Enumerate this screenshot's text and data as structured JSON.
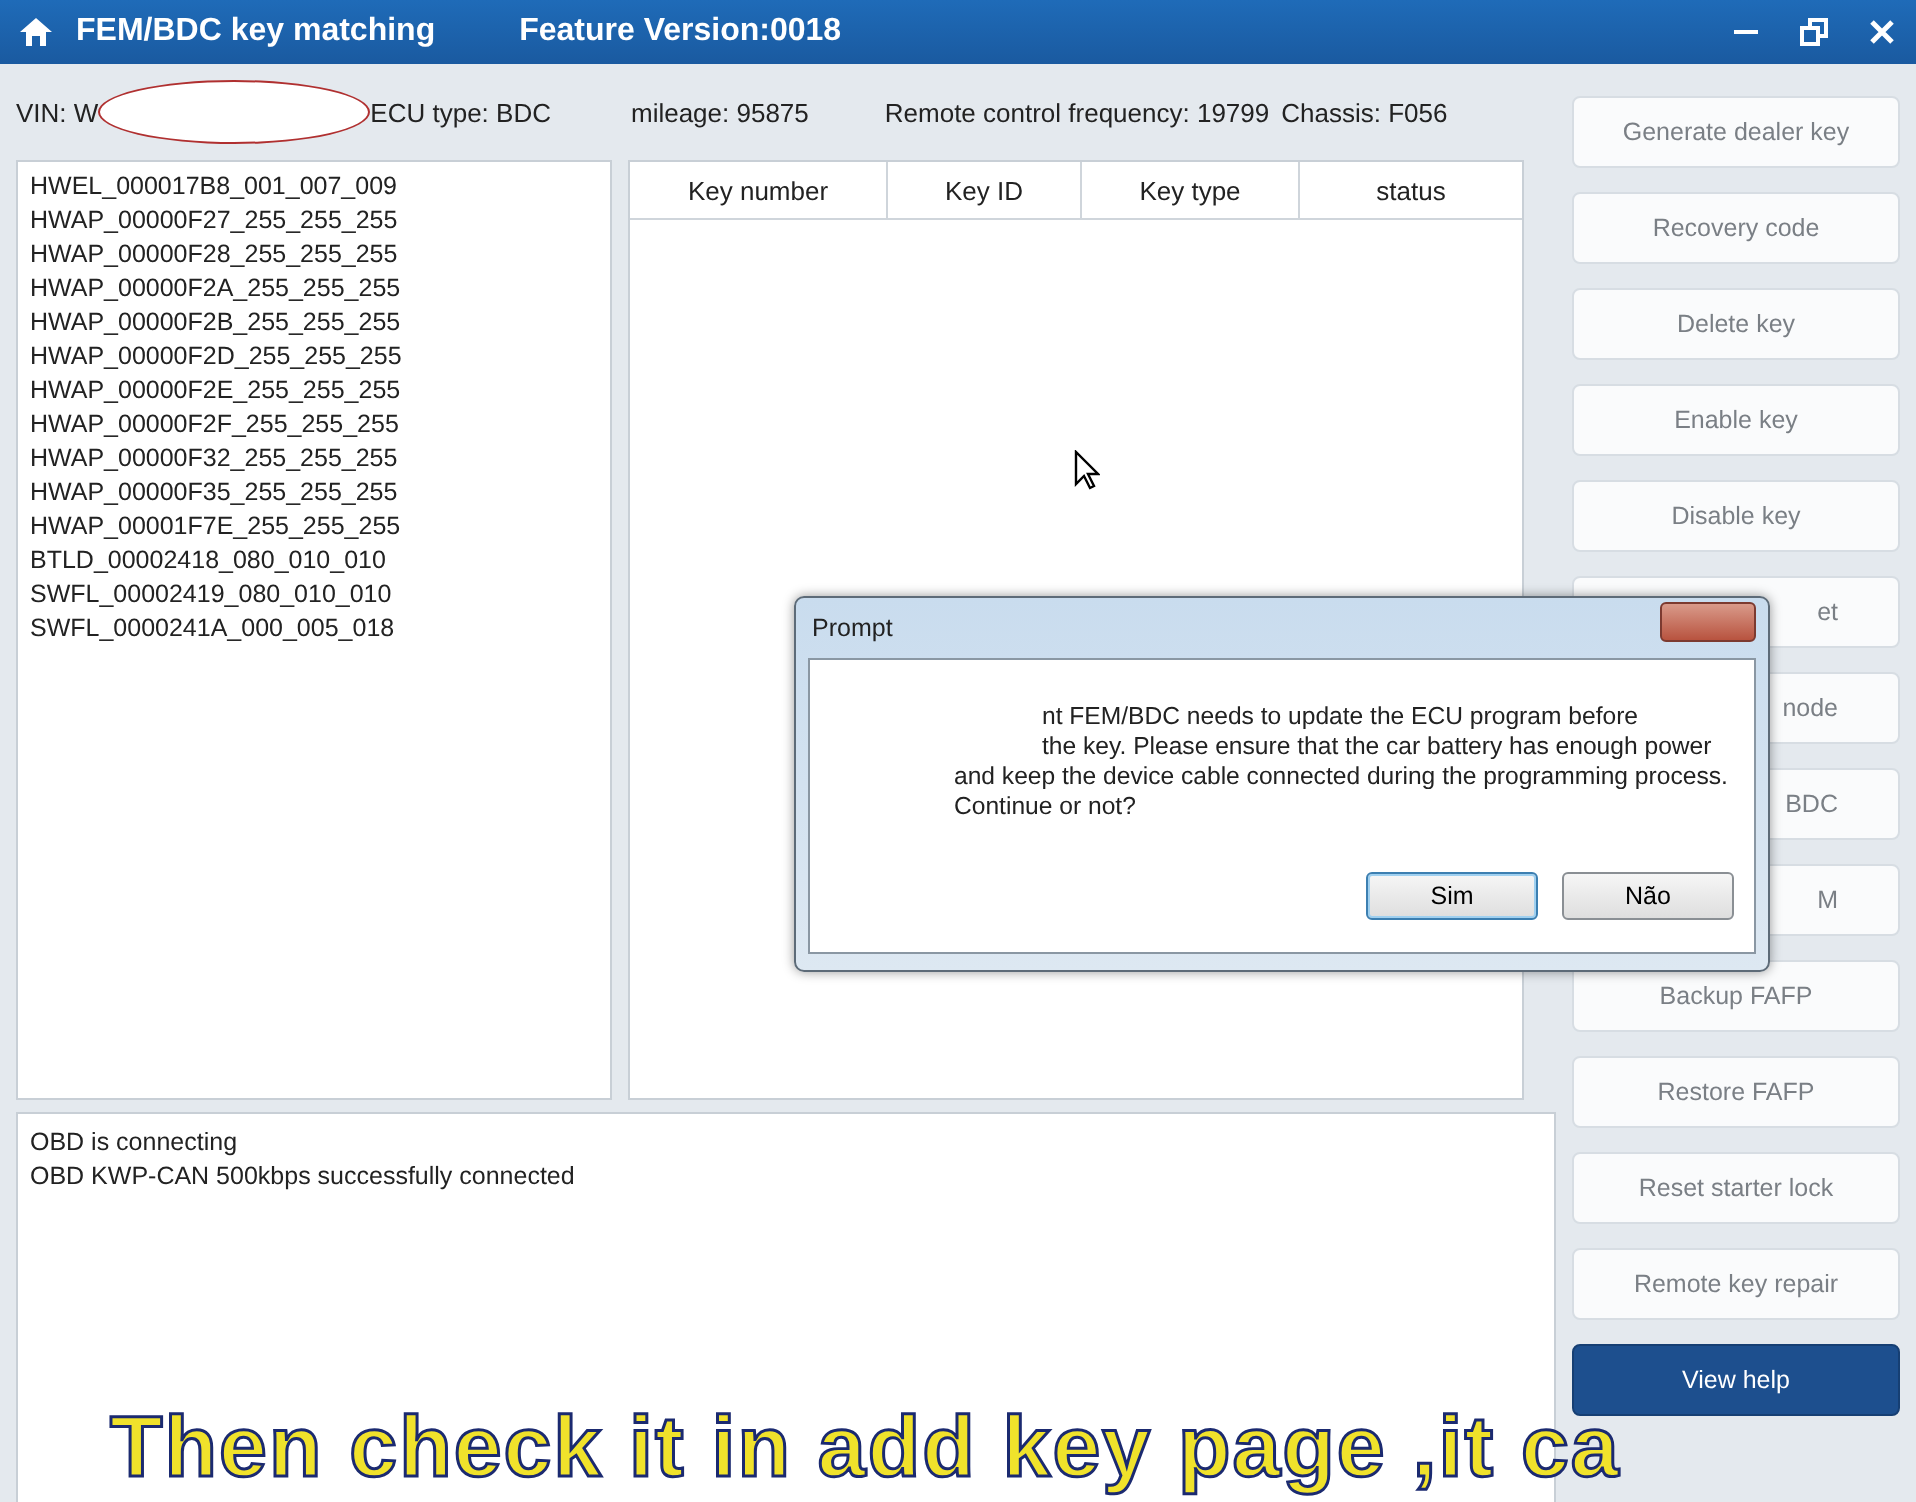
{
  "window": {
    "title": "FEM/BDC key matching",
    "feature_version": "Feature Version:0018"
  },
  "info": {
    "vin": "VIN: W",
    "ecu_type": "ECU type: BDC",
    "mileage": "mileage: 95875",
    "frequency": "Remote control frequency: 19799",
    "chassis": "Chassis: F056"
  },
  "modules": [
    "HWEL_000017B8_001_007_009",
    "HWAP_00000F27_255_255_255",
    "HWAP_00000F28_255_255_255",
    "HWAP_00000F2A_255_255_255",
    "HWAP_00000F2B_255_255_255",
    "HWAP_00000F2D_255_255_255",
    "HWAP_00000F2E_255_255_255",
    "HWAP_00000F2F_255_255_255",
    "HWAP_00000F32_255_255_255",
    "HWAP_00000F35_255_255_255",
    "HWAP_00001F7E_255_255_255",
    "BTLD_00002418_080_010_010",
    "SWFL_00002419_080_010_010",
    "SWFL_0000241A_000_005_018"
  ],
  "table": {
    "columns": [
      "Key number",
      "Key ID",
      "Key type",
      "status"
    ]
  },
  "log": [
    "OBD is connecting",
    "OBD KWP-CAN 500kbps successfully connected"
  ],
  "buttons": [
    {
      "label": "Generate dealer key",
      "kind": "full",
      "selected": false
    },
    {
      "label": "Recovery code",
      "kind": "full",
      "selected": false
    },
    {
      "label": "Delete key",
      "kind": "full",
      "selected": false
    },
    {
      "label": "Enable key",
      "kind": "full",
      "selected": false
    },
    {
      "label": "Disable key",
      "kind": "full",
      "selected": false
    },
    {
      "label": "et",
      "kind": "partial",
      "selected": false
    },
    {
      "label": "node",
      "kind": "partial",
      "selected": false
    },
    {
      "label": "BDC",
      "kind": "partial",
      "selected": false
    },
    {
      "label": "M",
      "kind": "partial",
      "selected": false
    },
    {
      "label": "Backup FAFP",
      "kind": "full",
      "selected": false
    },
    {
      "label": "Restore FAFP",
      "kind": "full",
      "selected": false
    },
    {
      "label": "Reset starter lock",
      "kind": "full",
      "selected": false
    },
    {
      "label": "Remote key repair",
      "kind": "full",
      "selected": false
    },
    {
      "label": "View help",
      "kind": "full",
      "selected": true
    }
  ],
  "dialog": {
    "title": "Prompt",
    "lines": [
      {
        "text": "nt FEM/BDC needs to update the ECU program before",
        "kind": "partial"
      },
      {
        "text": "the key. Please ensure that the car battery has enough power",
        "kind": "partial"
      },
      {
        "text": "and keep the device cable connected during the programming process.",
        "kind": "full"
      },
      {
        "text": "Continue or not?",
        "kind": "full"
      }
    ],
    "buttons": [
      {
        "label": "Sim",
        "selected": true
      },
      {
        "label": "Não",
        "selected": false
      }
    ]
  },
  "caption": "Then check it in add key page ,it ca"
}
